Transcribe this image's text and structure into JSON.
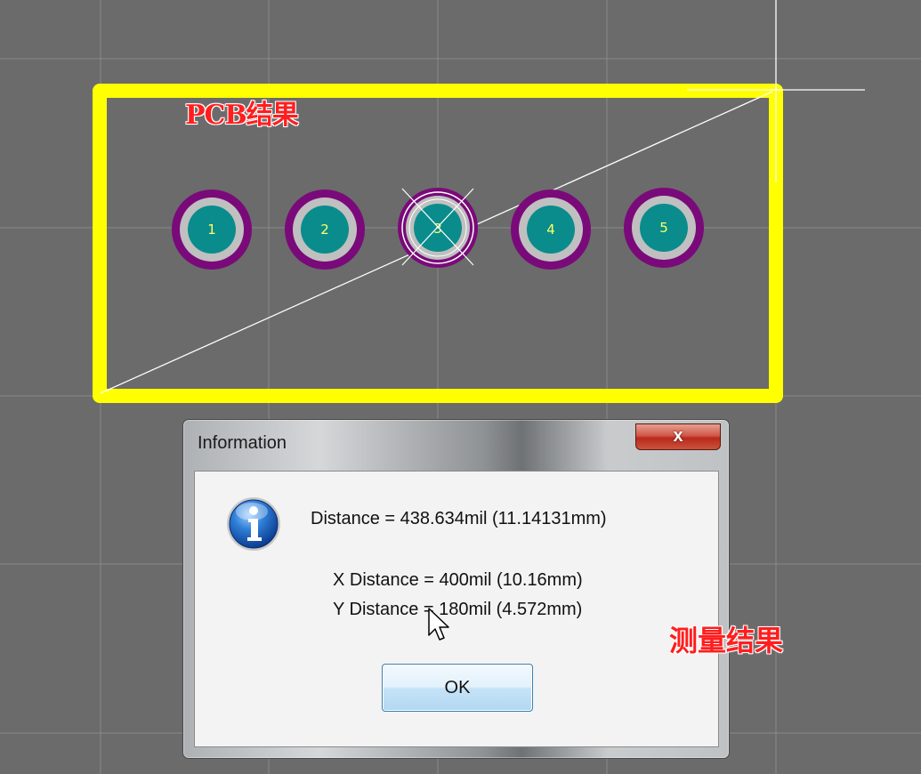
{
  "annotations": {
    "pcb_result": "PCB结果",
    "measure_result": "测量结果"
  },
  "pads": [
    {
      "number": "1"
    },
    {
      "number": "2"
    },
    {
      "number": "3"
    },
    {
      "number": "4"
    },
    {
      "number": "5"
    }
  ],
  "colors": {
    "canvas_background": "#6b6b6b",
    "grid_line": "#8c8c8c",
    "board_outline": "#ffff00",
    "pad_ring": "#7a0a7a",
    "pad_hole_ring": "#c0c0c0",
    "pad_fill": "#0a8c8c",
    "measure_line": "#ffffff",
    "annotation_text": "#ff1e1e"
  },
  "dialog": {
    "title": "Information",
    "close_glyph": "x",
    "message_distance": "Distance = 438.634mil (11.14131mm)",
    "message_x": "X Distance = 400mil (10.16mm)",
    "message_y": "Y Distance = 180mil (4.572mm)",
    "ok_label": "OK",
    "icon": "info-icon"
  }
}
